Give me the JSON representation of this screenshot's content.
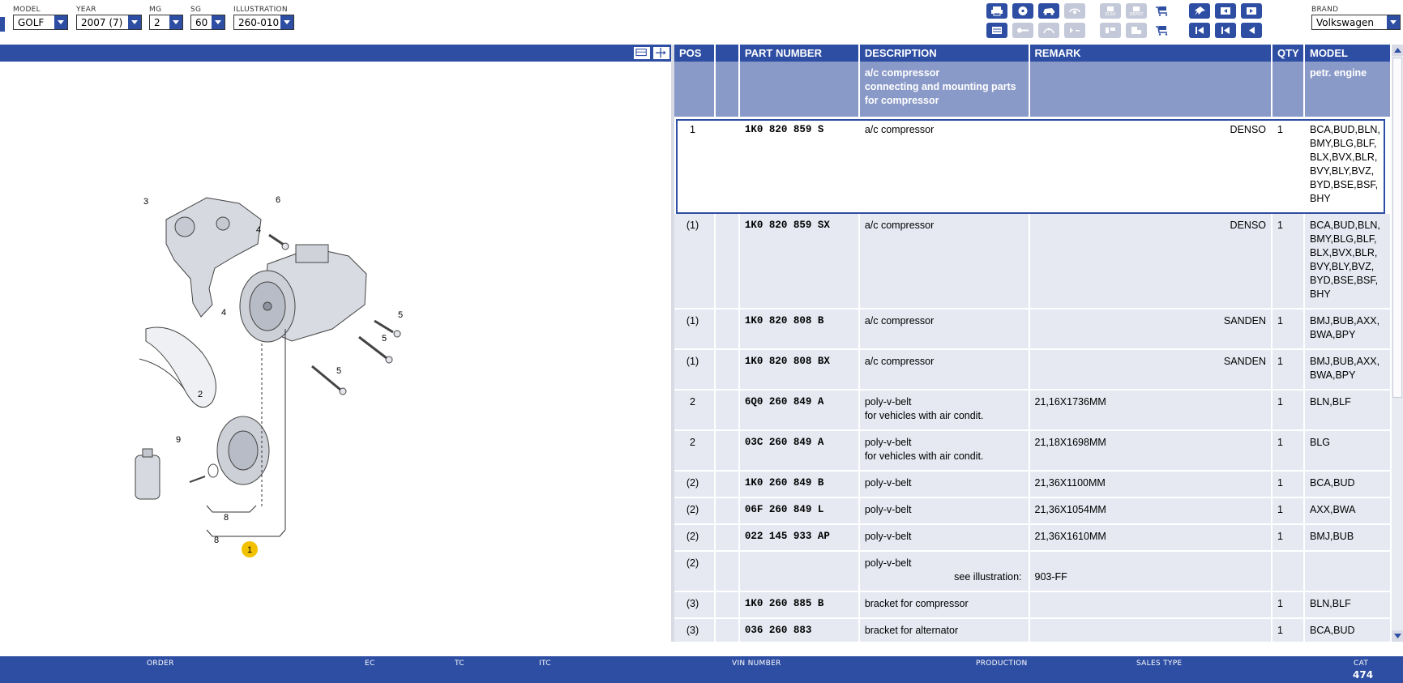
{
  "filters": {
    "model": {
      "label": "MODEL",
      "value": "GOLF"
    },
    "year": {
      "label": "YEAR",
      "value": "2007 (7)"
    },
    "mg": {
      "label": "MG",
      "value": "2"
    },
    "sg": {
      "label": "SG",
      "value": "60"
    },
    "illustration": {
      "label": "ILLUSTRATION",
      "value": "260-010"
    },
    "brand": {
      "label": "BRAND",
      "value": "Volkswagen"
    }
  },
  "toolbar": {
    "elsa_label": "ELSA",
    "depot_label": "DEPOT"
  },
  "table": {
    "headers": [
      "POS",
      "",
      "PART NUMBER",
      "DESCRIPTION",
      "REMARK",
      "QTY",
      "MODEL"
    ],
    "group": {
      "description": [
        "a/c compressor",
        "connecting and mounting parts",
        "for compressor"
      ],
      "model": "petr. engine"
    },
    "rows": [
      {
        "pos": "1",
        "part": "1K0 820 859 S",
        "desc": [
          "a/c compressor"
        ],
        "remark": "DENSO",
        "remark_align": "right",
        "qty": "1",
        "model": [
          "BCA,BUD,BLN,",
          "BMY,BLG,BLF,",
          "BLX,BVX,BLR,",
          "BVY,BLY,BVZ,",
          "BYD,BSE,BSF,",
          "BHY"
        ]
      },
      {
        "pos": "(1)",
        "part": "1K0 820 859 SX",
        "desc": [
          "a/c compressor"
        ],
        "remark": "DENSO",
        "remark_align": "right",
        "qty": "1",
        "model": [
          "BCA,BUD,BLN,",
          "BMY,BLG,BLF,",
          "BLX,BVX,BLR,",
          "BVY,BLY,BVZ,",
          "BYD,BSE,BSF,",
          "BHY"
        ]
      },
      {
        "pos": "(1)",
        "part": "1K0 820 808 B",
        "desc": [
          "a/c compressor"
        ],
        "remark": "SANDEN",
        "remark_align": "right",
        "qty": "1",
        "model": [
          "BMJ,BUB,AXX,",
          "BWA,BPY"
        ]
      },
      {
        "pos": "(1)",
        "part": "1K0 820 808 BX",
        "desc": [
          "a/c compressor"
        ],
        "remark": "SANDEN",
        "remark_align": "right",
        "qty": "1",
        "model": [
          "BMJ,BUB,AXX,",
          "BWA,BPY"
        ]
      },
      {
        "pos": "2",
        "part": "6Q0 260 849 A",
        "desc": [
          "poly-v-belt",
          "for vehicles with air condit."
        ],
        "remark": "21,16X1736MM",
        "remark_align": "left",
        "qty": "1",
        "model": [
          "BLN,BLF"
        ]
      },
      {
        "pos": "2",
        "part": "03C 260 849 A",
        "desc": [
          "poly-v-belt",
          "for vehicles with air condit."
        ],
        "remark": "21,18X1698MM",
        "remark_align": "left",
        "qty": "1",
        "model": [
          "BLG"
        ]
      },
      {
        "pos": "(2)",
        "part": "1K0 260 849 B",
        "desc": [
          "poly-v-belt"
        ],
        "remark": "21,36X1100MM",
        "remark_align": "left",
        "qty": "1",
        "model": [
          "BCA,BUD"
        ]
      },
      {
        "pos": "(2)",
        "part": "06F 260 849 L",
        "desc": [
          "poly-v-belt"
        ],
        "remark": "21,36X1054MM",
        "remark_align": "left",
        "qty": "1",
        "model": [
          "AXX,BWA"
        ]
      },
      {
        "pos": "(2)",
        "part": "022 145 933 AP",
        "desc": [
          "poly-v-belt"
        ],
        "remark": "21,36X1610MM",
        "remark_align": "left",
        "qty": "1",
        "model": [
          "BMJ,BUB"
        ]
      },
      {
        "pos": "(2)",
        "part": "",
        "desc": [
          "poly-v-belt"
        ],
        "see_label": "see illustration:",
        "remark": "903-FF",
        "remark_align": "left",
        "qty": "",
        "model": []
      },
      {
        "pos": "(3)",
        "part": "1K0 260 885 B",
        "desc": [
          "bracket for compressor"
        ],
        "remark": "",
        "remark_align": "left",
        "qty": "1",
        "model": [
          "BLN,BLF"
        ]
      },
      {
        "pos": "(3)",
        "part": "036 260 883",
        "desc": [
          "bracket for alternator"
        ],
        "remark": "",
        "remark_align": "left",
        "qty": "1",
        "model": [
          "BCA,BUD"
        ]
      }
    ]
  },
  "illustration": {
    "callouts": [
      "1",
      "2",
      "3",
      "4",
      "4",
      "5",
      "5",
      "5",
      "6",
      "8",
      "8",
      "9"
    ]
  },
  "bottom": {
    "order_label": "ORDER",
    "ec_label": "EC",
    "tc_label": "TC",
    "itc_label": "ITC",
    "vin_label": "VIN NUMBER",
    "production_label": "PRODUCTION",
    "sales_type_label": "SALES TYPE",
    "cat_label": "CAT",
    "cat_value": "474"
  },
  "colors": {
    "primary": "#2d4ea3",
    "group_row": "#8a9ac8",
    "row_bg": "#e6e9f2",
    "callout_highlight": "#f2c200"
  }
}
